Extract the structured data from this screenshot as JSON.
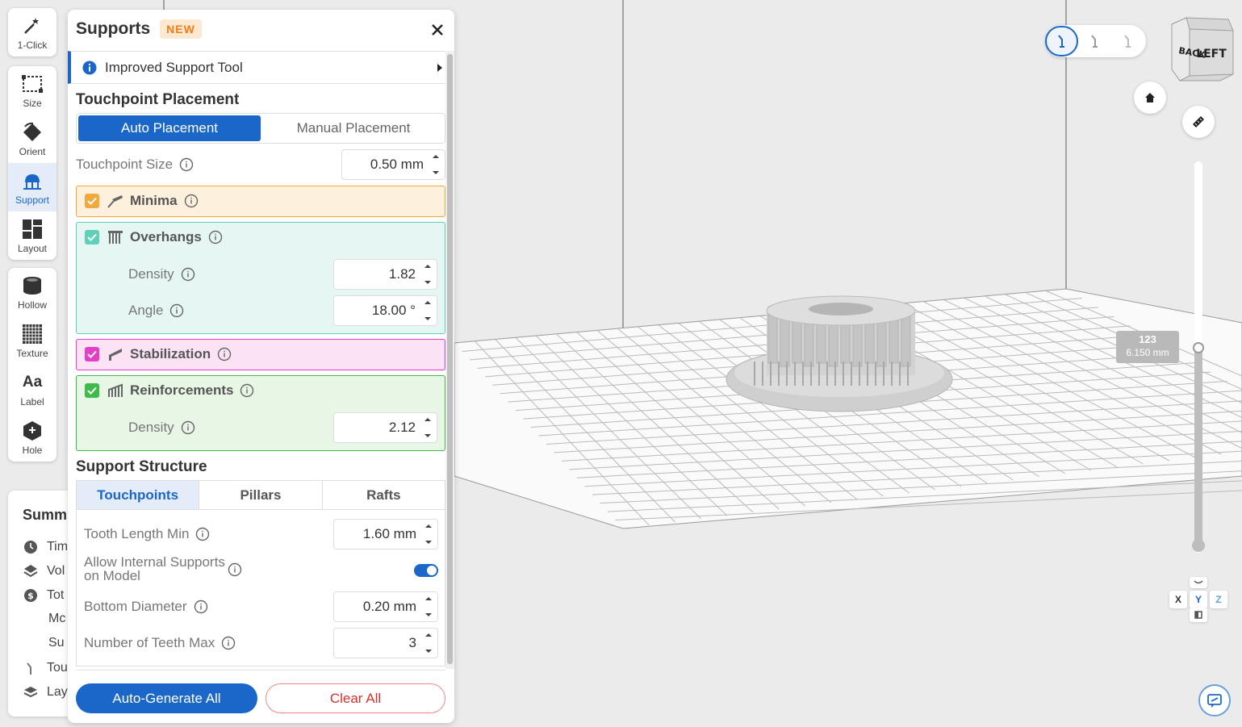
{
  "toolbar": {
    "group1": [
      {
        "label": "1-Click",
        "icon": "magic-wand-icon"
      }
    ],
    "group2": [
      {
        "label": "Size",
        "icon": "size-icon"
      },
      {
        "label": "Orient",
        "icon": "orient-icon"
      },
      {
        "label": "Support",
        "icon": "support-icon",
        "active": true
      },
      {
        "label": "Layout",
        "icon": "layout-icon"
      }
    ],
    "group3": [
      {
        "label": "Hollow",
        "icon": "hollow-icon"
      },
      {
        "label": "Texture",
        "icon": "texture-icon"
      },
      {
        "label": "Label",
        "icon": "label-icon"
      },
      {
        "label": "Hole",
        "icon": "hole-icon"
      }
    ]
  },
  "summary": {
    "title": "Summ",
    "rows": [
      {
        "text": "Tim",
        "icon": "clock-icon"
      },
      {
        "text": "Vol",
        "icon": "volume-icon"
      },
      {
        "text": "Tot",
        "icon": "dollar-icon"
      },
      {
        "text": "Mc",
        "icon": ""
      },
      {
        "text": "Su",
        "icon": ""
      },
      {
        "text": "Tou",
        "icon": "touchpoint-icon"
      },
      {
        "text": "Lay",
        "icon": "layers-icon"
      }
    ]
  },
  "panel": {
    "title": "Supports",
    "badge": "NEW",
    "info": "Improved Support Tool",
    "placement": {
      "title": "Touchpoint Placement",
      "auto": "Auto Placement",
      "manual": "Manual Placement",
      "touchpoint_size_label": "Touchpoint Size",
      "touchpoint_size": "0.50 mm"
    },
    "minima": {
      "label": "Minima",
      "checked": true
    },
    "overhangs": {
      "label": "Overhangs",
      "checked": true,
      "density_label": "Density",
      "density": "1.82",
      "angle_label": "Angle",
      "angle": "18.00 °"
    },
    "stabilization": {
      "label": "Stabilization",
      "checked": true
    },
    "reinforcements": {
      "label": "Reinforcements",
      "checked": true,
      "density_label": "Density",
      "density": "2.12"
    },
    "structure": {
      "title": "Support Structure",
      "tabs": [
        "Touchpoints",
        "Pillars",
        "Rafts"
      ],
      "active_tab": "Touchpoints",
      "tooth_length_label": "Tooth Length Min",
      "tooth_length": "1.60 mm",
      "internal_label_1": "Allow Internal Supports",
      "internal_label_2": "on Model",
      "internal_enabled": true,
      "bottom_diameter_label": "Bottom Diameter",
      "bottom_diameter": "0.20 mm",
      "teeth_max_label": "Number of Teeth Max",
      "teeth_max": "3"
    },
    "buttons": {
      "generate": "Auto-Generate All",
      "clear": "Clear All"
    }
  },
  "viewport": {
    "cube_back": "BACK",
    "cube_left": "LEFT",
    "layer_number": "123",
    "layer_height": "6.150 mm",
    "axes": {
      "x": "X",
      "y": "Y",
      "z": "Z"
    }
  },
  "colors": {
    "accent": "#1b67c9",
    "minima": "#f0a93a",
    "overhangs": "#5fd1b9",
    "stabilization": "#e33fc4",
    "reinforcements": "#3dbb4b",
    "danger": "#d6302f"
  }
}
